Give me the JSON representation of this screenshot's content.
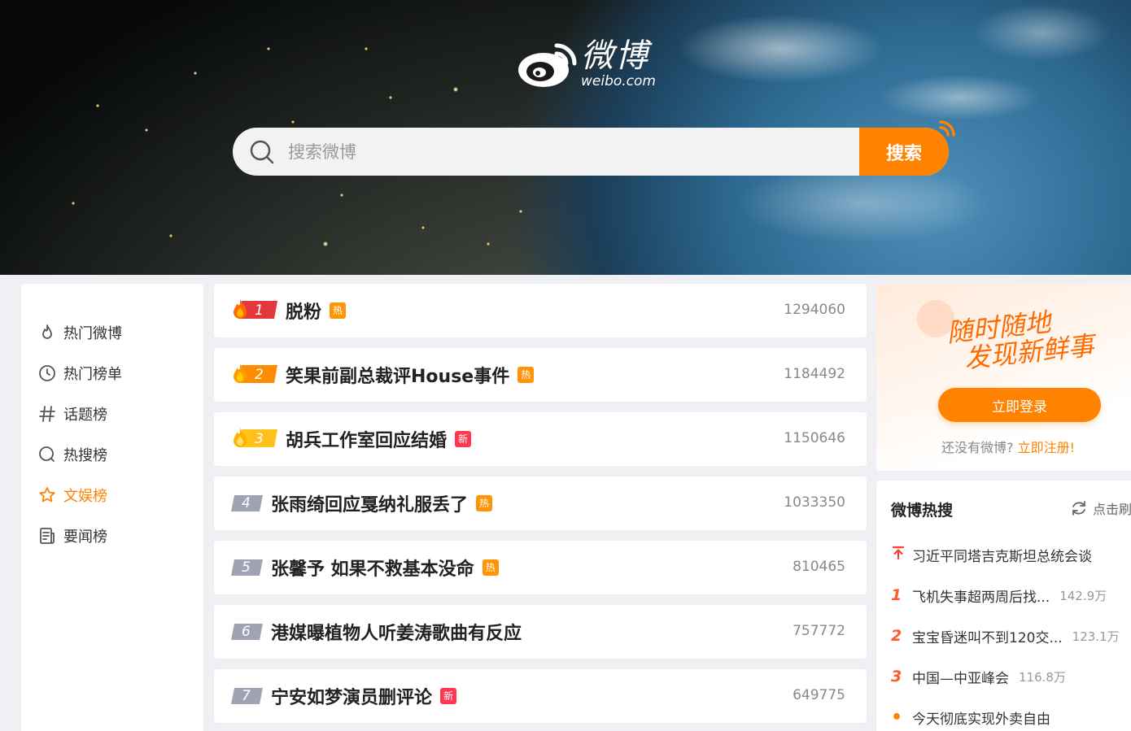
{
  "brand": {
    "name_cn": "微博",
    "name_en": "weibo.com"
  },
  "search": {
    "placeholder": "搜索微博",
    "button_label": "搜索"
  },
  "sidebar": {
    "items": [
      {
        "label": "热门微博",
        "icon": "flame-outline-icon"
      },
      {
        "label": "热门榜单",
        "icon": "clock-icon"
      },
      {
        "label": "话题榜",
        "icon": "hashtag-icon"
      },
      {
        "label": "热搜榜",
        "icon": "search-circle-icon"
      },
      {
        "label": "文娱榜",
        "icon": "star-icon",
        "active": true
      },
      {
        "label": "要闻榜",
        "icon": "news-icon"
      }
    ]
  },
  "ranking": {
    "items": [
      {
        "rank": "1",
        "title": "脱粉",
        "tag": "热",
        "tag_type": "hot",
        "count": "1294060"
      },
      {
        "rank": "2",
        "title": "笑果前副总裁评House事件",
        "tag": "热",
        "tag_type": "hot",
        "count": "1184492"
      },
      {
        "rank": "3",
        "title": "胡兵工作室回应结婚",
        "tag": "新",
        "tag_type": "new",
        "count": "1150646"
      },
      {
        "rank": "4",
        "title": "张雨绮回应戛纳礼服丢了",
        "tag": "热",
        "tag_type": "hot",
        "count": "1033350"
      },
      {
        "rank": "5",
        "title": "张馨予 如果不救基本没命",
        "tag": "热",
        "tag_type": "hot",
        "count": "810465"
      },
      {
        "rank": "6",
        "title": "港媒曝植物人听姜涛歌曲有反应",
        "tag": "",
        "tag_type": "",
        "count": "757772"
      },
      {
        "rank": "7",
        "title": "宁安如梦演员删评论",
        "tag": "新",
        "tag_type": "new",
        "count": "649775"
      }
    ]
  },
  "login_card": {
    "slogan_line1": "随时随地",
    "slogan_line2": "发现新鲜事",
    "login_button": "立即登录",
    "no_account_text": "还没有微博?",
    "register_link": "立即注册!"
  },
  "hot_search": {
    "title": "微博热搜",
    "refresh_label": "点击刷",
    "items": [
      {
        "rank": "",
        "marker": "pin-top-icon",
        "text": "习近平同塔吉克斯坦总统会谈",
        "heat": ""
      },
      {
        "rank": "1",
        "text": "飞机失事超两周后找...",
        "heat": "142.9万"
      },
      {
        "rank": "2",
        "text": "宝宝昏迷叫不到120交...",
        "heat": "123.1万"
      },
      {
        "rank": "3",
        "text": "中国—中亚峰会",
        "heat": "116.8万"
      },
      {
        "rank": "•",
        "text": "今天彻底实现外卖自由",
        "heat": ""
      }
    ]
  },
  "colors": {
    "accent": "#ff8200",
    "hot_tag": "#ff9406",
    "new_tag": "#ff3852",
    "rank_red": "#ff5a2a"
  }
}
